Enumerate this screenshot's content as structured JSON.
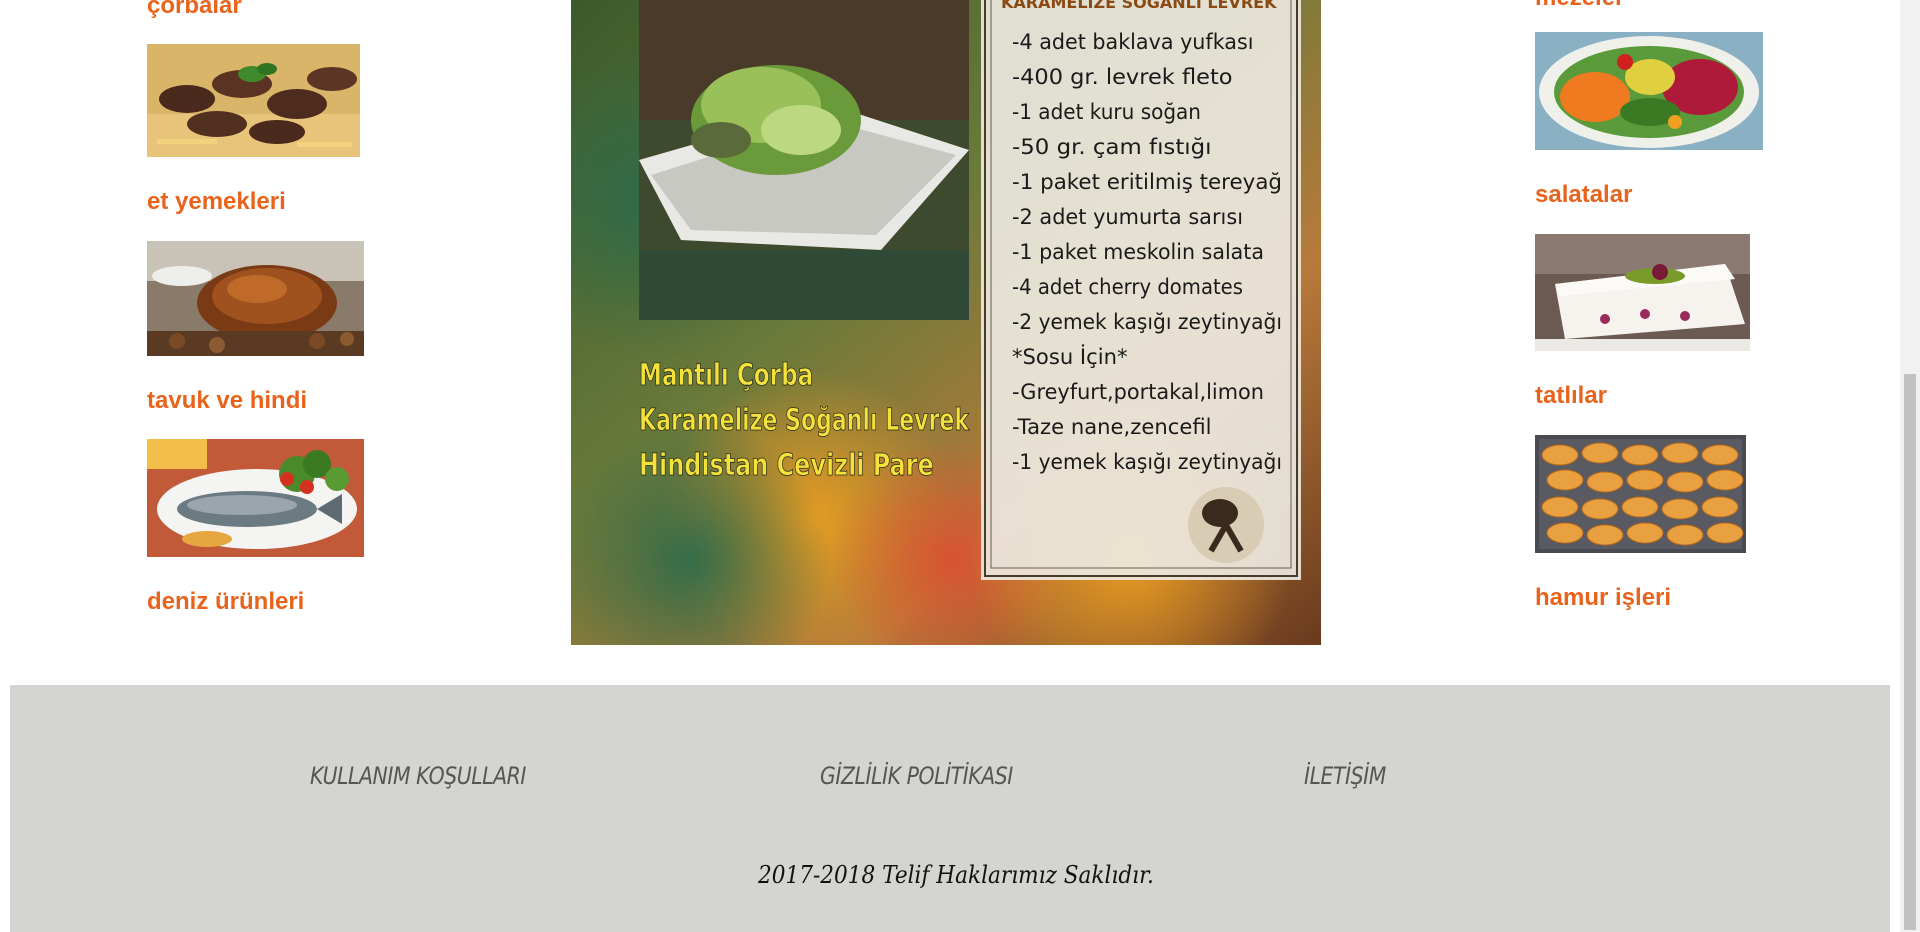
{
  "left_categories": {
    "corbalar": "çorbalar",
    "et": "et yemekleri",
    "tavuk": "tavuk ve hindi",
    "deniz": "deniz ürünleri"
  },
  "right_categories": {
    "mezeler": "mezeler",
    "salatalar": "salatalar",
    "tatlilar": "tatlılar",
    "hamur": "hamur işleri"
  },
  "poster": {
    "recipe_title": "KARAMELIZE SOĞANLI LEVREK",
    "ingredients": [
      "-4 adet baklava yufkası",
      "-400 gr. levrek fleto",
      "-1 adet kuru soğan",
      "-50 gr. çam fıstığı",
      "-1 paket eritilmiş tereyağ",
      "-2 adet yumurta sarısı",
      "-1 paket meskolin salata",
      "-4 adet cherry domates",
      "-2 yemek kaşığı zeytinyağı",
      "*Sosu İçin*",
      "-Greyfurt,portakal,limon",
      "-Taze nane,zencefil",
      "-1 yemek kaşığı zeytinyağı"
    ],
    "menu": [
      "Mantılı Çorba",
      "Karamelize Soğanlı Levrek",
      "Hindistan Cevizli Pare"
    ]
  },
  "footer": {
    "terms": "KULLANIM KOŞULLARI",
    "privacy": "GİZLİLİK POLİTİKASI",
    "contact": "İLETİŞİM",
    "copyright": "2017-2018 Telif Haklarımız Saklıdır."
  },
  "colors": {
    "link": "#e8641c",
    "footer_bg": "#d4d5d1"
  }
}
